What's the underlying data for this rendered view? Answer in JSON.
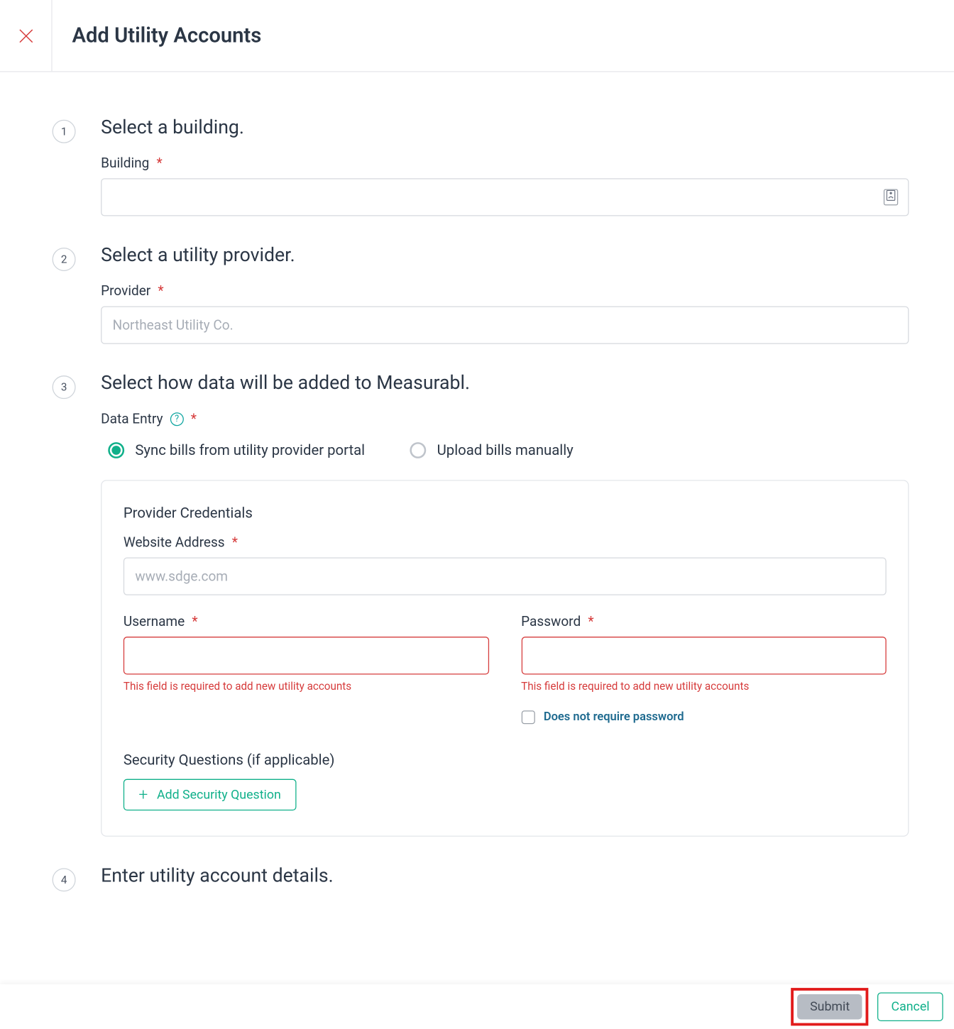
{
  "header": {
    "title": "Add Utility Accounts"
  },
  "steps": {
    "s1": {
      "num": "1",
      "title": "Select a building.",
      "building_label": "Building"
    },
    "s2": {
      "num": "2",
      "title": "Select a utility provider.",
      "provider_label": "Provider",
      "provider_placeholder": "Northeast Utility Co."
    },
    "s3": {
      "num": "3",
      "title": "Select how data will be added to Measurabl.",
      "data_entry_label": "Data Entry",
      "radio_sync": "Sync bills from utility provider portal",
      "radio_upload": "Upload bills manually",
      "cred_title": "Provider Credentials",
      "website_label": "Website Address",
      "website_placeholder": "www.sdge.com",
      "username_label": "Username",
      "password_label": "Password",
      "err_msg": "This field is required to add new utility accounts",
      "no_password_label": "Does not require password",
      "secq_label": "Security Questions (if applicable)",
      "addq_label": "Add Security Question"
    },
    "s4": {
      "num": "4",
      "title": "Enter utility account details."
    }
  },
  "footer": {
    "submit": "Submit",
    "cancel": "Cancel"
  },
  "asterisk": "*",
  "help_q": "?",
  "plus": "+"
}
